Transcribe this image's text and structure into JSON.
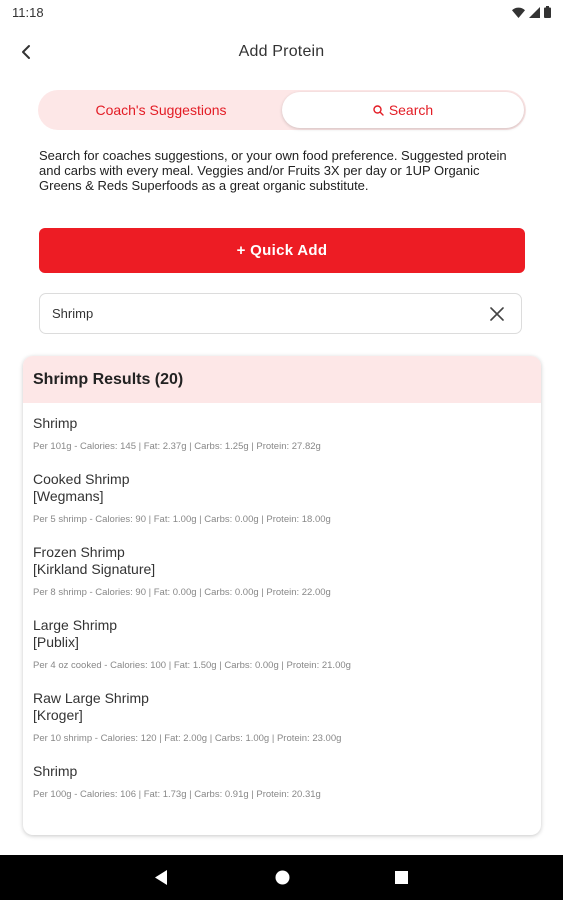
{
  "status_bar": {
    "time": "11:18"
  },
  "header": {
    "title": "Add Protein"
  },
  "tabs": [
    {
      "label": "Coach's Suggestions"
    },
    {
      "label": "Search"
    }
  ],
  "help_text": "Search for coaches suggestions, or your own food preference. Suggested protein and carbs with every meal. Veggies and/or Fruits 3X per day or 1UP Organic Greens & Reds Superfoods as a great organic substitute.",
  "quick_add_label": "+ Quick Add",
  "search": {
    "value": "Shrimp"
  },
  "results": {
    "title": "Shrimp Results (20)",
    "items": [
      {
        "name": "Shrimp",
        "brand": "",
        "meta": "Per 101g - Calories: 145 | Fat: 2.37g | Carbs: 1.25g | Protein: 27.82g"
      },
      {
        "name": "Cooked Shrimp",
        "brand": "[Wegmans]",
        "meta": "Per 5 shrimp - Calories: 90 | Fat: 1.00g | Carbs: 0.00g | Protein: 18.00g"
      },
      {
        "name": "Frozen Shrimp",
        "brand": "[Kirkland Signature]",
        "meta": "Per 8 shrimp - Calories: 90 | Fat: 0.00g | Carbs: 0.00g | Protein: 22.00g"
      },
      {
        "name": "Large Shrimp",
        "brand": "[Publix]",
        "meta": "Per 4 oz cooked - Calories: 100 | Fat: 1.50g | Carbs: 0.00g | Protein: 21.00g"
      },
      {
        "name": "Raw Large Shrimp",
        "brand": "[Kroger]",
        "meta": "Per 10 shrimp - Calories: 120 | Fat: 2.00g | Carbs: 1.00g | Protein: 23.00g"
      },
      {
        "name": "Shrimp",
        "brand": "",
        "meta": "Per 100g - Calories: 106 | Fat: 1.73g | Carbs: 0.91g | Protein: 20.31g"
      }
    ]
  },
  "colors": {
    "accent": "#ed1c24",
    "tint": "#fde7e7"
  }
}
